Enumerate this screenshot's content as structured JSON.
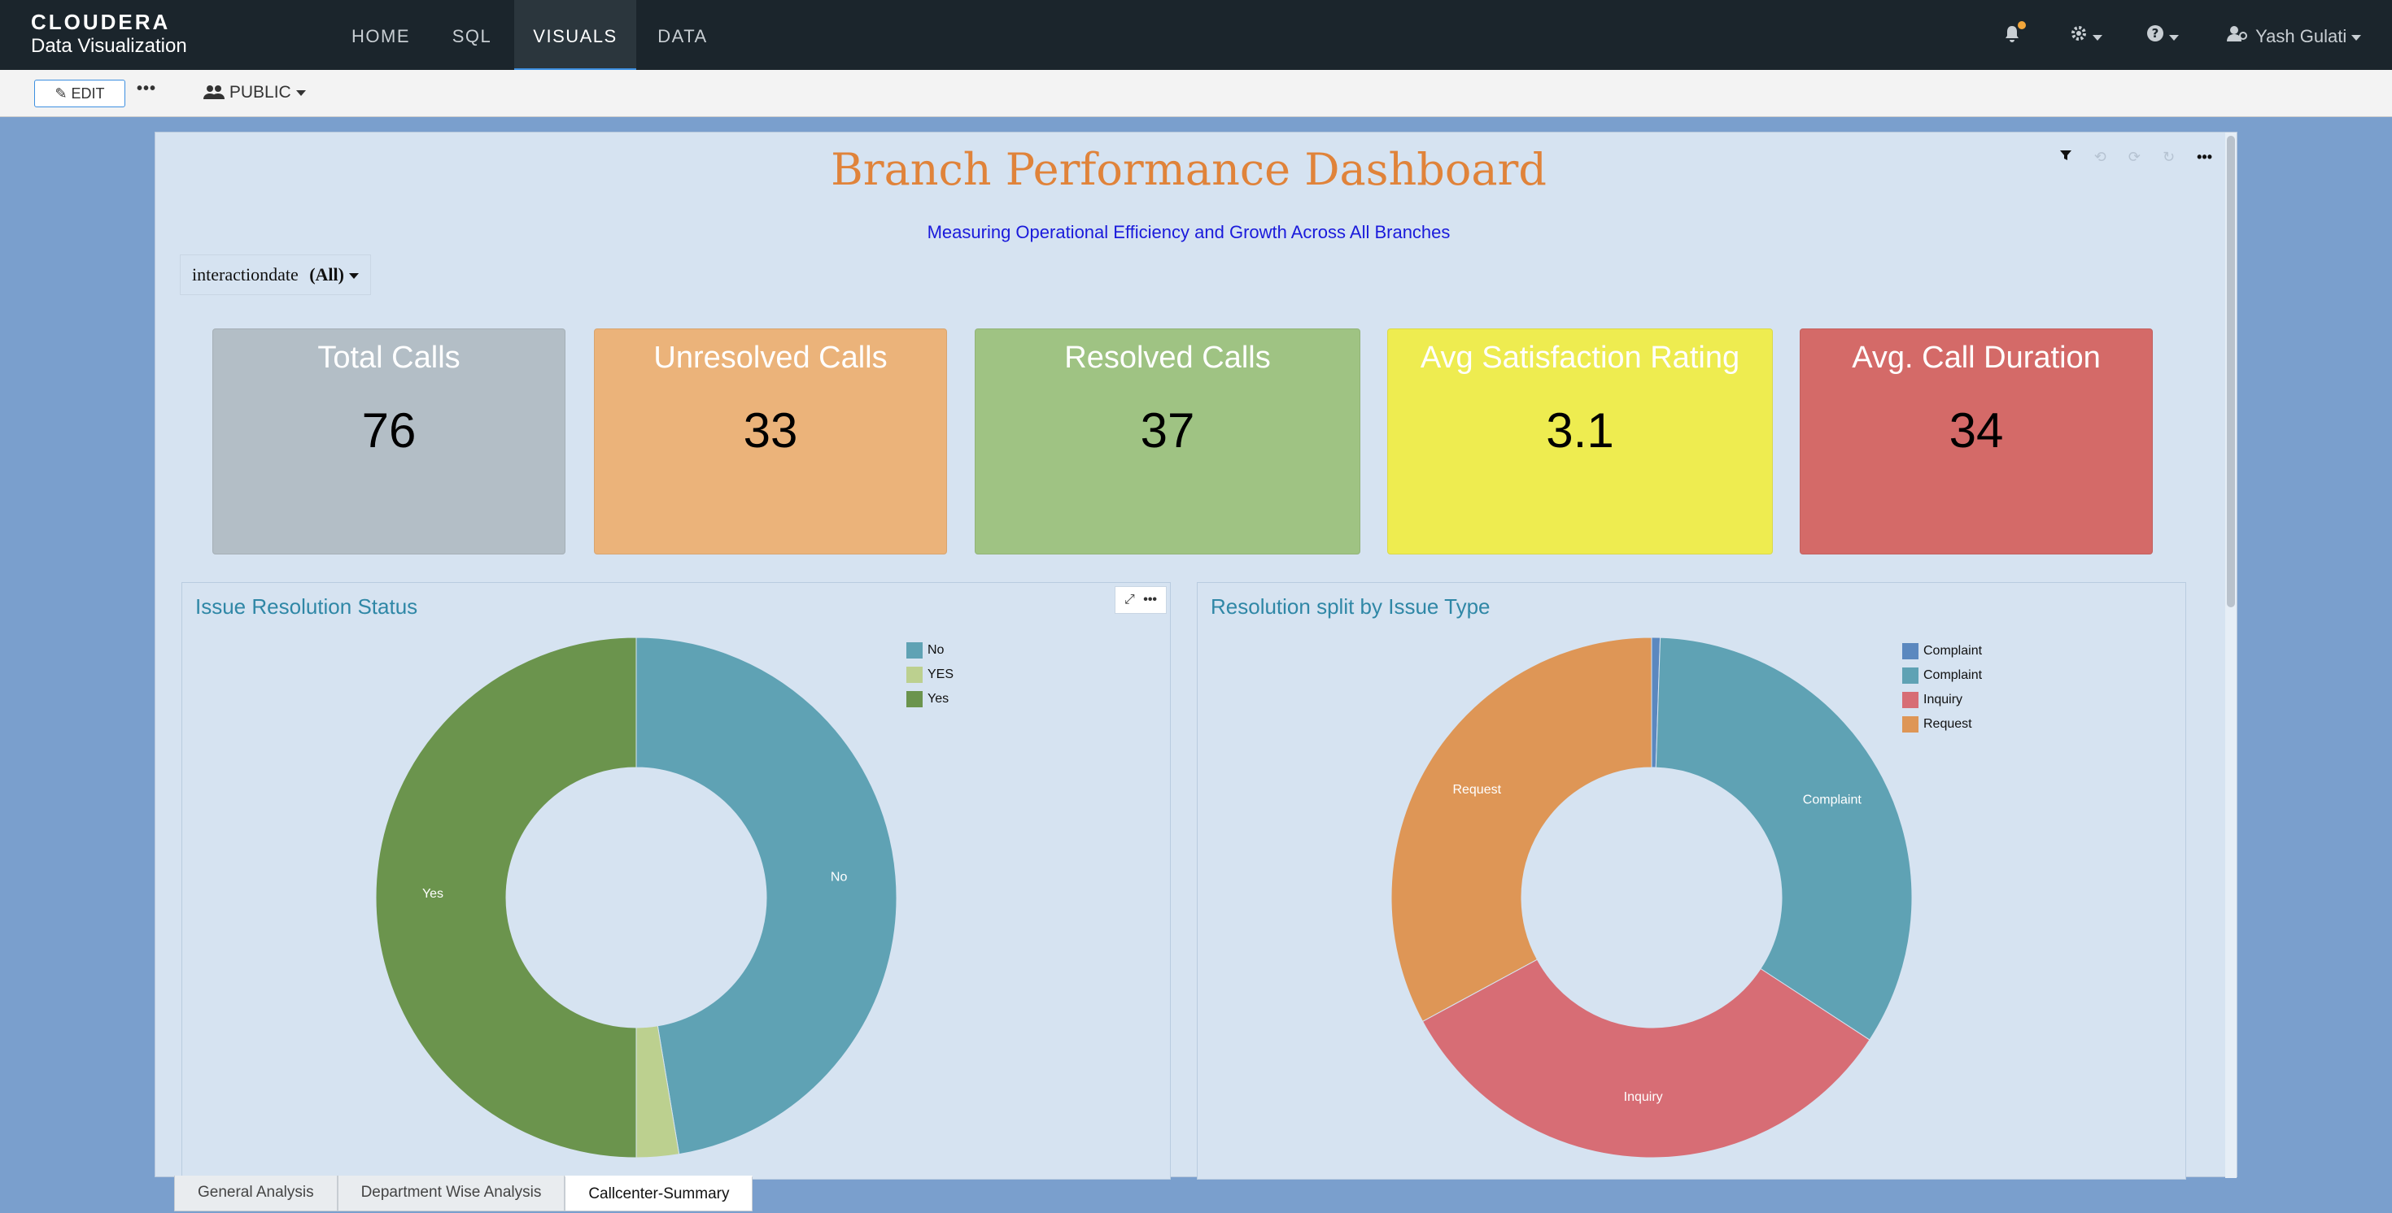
{
  "brand": {
    "line1": "CLOUDERA",
    "line2": "Data Visualization"
  },
  "nav": {
    "items": [
      {
        "label": "HOME"
      },
      {
        "label": "SQL"
      },
      {
        "label": "VISUALS"
      },
      {
        "label": "DATA"
      }
    ],
    "active": "VISUALS",
    "user_name": "Yash Gulati"
  },
  "toolbar": {
    "edit_label": "EDIT",
    "more_label": "•••",
    "visibility_label": "PUBLIC"
  },
  "dashboard": {
    "title": "Branch Performance Dashboard",
    "subtitle": "Measuring Operational Efficiency and Growth Across All Branches",
    "filter": {
      "field": "interactiondate",
      "value": "(All)"
    },
    "tool_more": "•••"
  },
  "kpis": [
    {
      "label": "Total Calls",
      "value": "76",
      "color": "#b3bec6"
    },
    {
      "label": "Unresolved Calls",
      "value": "33",
      "color": "#ebb37a"
    },
    {
      "label": "Resolved Calls",
      "value": "37",
      "color": "#9fc383"
    },
    {
      "label": "Avg Satisfaction Rating",
      "value": "3.1",
      "color": "#eeec50"
    },
    {
      "label": "Avg. Call Duration",
      "value": "34",
      "color": "#d46a68"
    }
  ],
  "panels": {
    "left": {
      "title": "Issue Resolution Status"
    },
    "right": {
      "title": "Resolution split by Issue Type"
    }
  },
  "chart_data": [
    {
      "type": "pie",
      "title": "Issue Resolution Status",
      "donut": true,
      "categories": [
        "No",
        "YES",
        "Yes"
      ],
      "values": [
        36,
        2,
        38
      ],
      "colors": [
        "#5fa2b4",
        "#bcd08f",
        "#6b944d"
      ],
      "slice_labels": [
        "No",
        "",
        "Yes"
      ],
      "legend": "top-right"
    },
    {
      "type": "pie",
      "title": "Resolution split by Issue Type",
      "donut": true,
      "categories": [
        "Complaint",
        "Complaint",
        "Inquiry",
        "Request"
      ],
      "values": [
        0.4,
        25.6,
        25,
        25
      ],
      "colors": [
        "#5b88bf",
        "#5fa2b4",
        "#d76d75",
        "#de9656"
      ],
      "slice_labels": [
        "",
        "Complaint",
        "Inquiry",
        "Request"
      ],
      "legend": "top-right"
    }
  ],
  "tabs": [
    {
      "label": "General Analysis"
    },
    {
      "label": "Department Wise Analysis"
    },
    {
      "label": "Callcenter-Summary"
    }
  ],
  "active_tab": "Callcenter-Summary"
}
